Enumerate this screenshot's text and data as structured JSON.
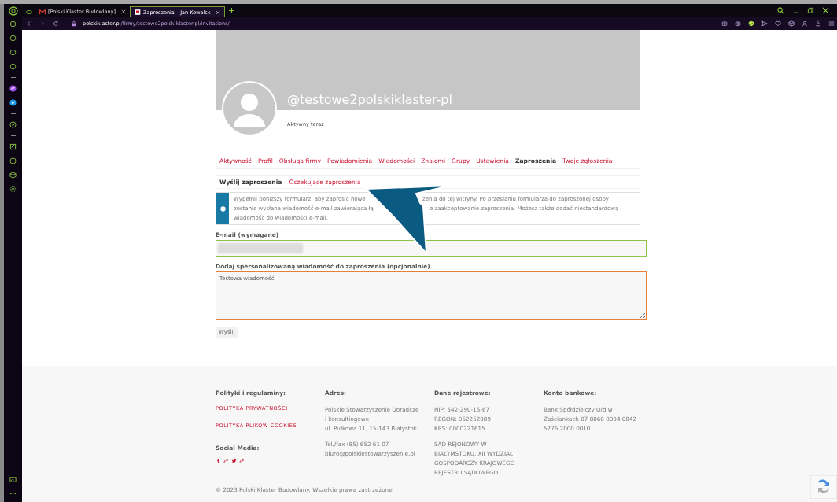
{
  "browser": {
    "tabs": [
      {
        "kind": "game",
        "selected": false
      },
      {
        "kind": "mail",
        "title": "[Polski Klaster Budowlany]",
        "selected": false
      },
      {
        "kind": "site",
        "title": "Zaproszenia – Jan Kowalsk",
        "selected": true
      }
    ],
    "url": {
      "domain": "polskiklaster.pl",
      "path": "/firmy/testowe2polskiklaster-pl/invitations/"
    }
  },
  "profile": {
    "username": "@testowe2polskiklaster-pl",
    "status": "Aktywny teraz"
  },
  "nav": [
    {
      "label": "Aktywność",
      "selected": false
    },
    {
      "label": "Profil",
      "selected": false
    },
    {
      "label": "Obsługa firmy",
      "selected": false
    },
    {
      "label": "Powiadomienia",
      "selected": false
    },
    {
      "label": "Wiadomości",
      "selected": false
    },
    {
      "label": "Znajomi",
      "selected": false
    },
    {
      "label": "Grupy",
      "selected": false
    },
    {
      "label": "Ustawienia",
      "selected": false
    },
    {
      "label": "Zaproszenia",
      "selected": true
    },
    {
      "label": "Twoje zgłoszenia",
      "selected": false
    }
  ],
  "subnav": [
    {
      "label": "Wyślij zaproszenia",
      "selected": true
    },
    {
      "label": "Oczekujące zaproszenia",
      "selected": false
    }
  ],
  "info": {
    "lines": [
      {
        "left": "Wypełnij poniższy formularz, aby zaprosić nowe",
        "right": "zenia do tej witryny. Po przesłaniu formularza do zaproszonej osoby"
      },
      {
        "left": "zostanie wysłana wiadomość e-mail zawierająca łą",
        "right": "e zaakceptowanie zaproszenia. Możesz także dodać niestandardową"
      },
      {
        "left": "wiadomość do wiadomości e-mail."
      }
    ]
  },
  "form": {
    "email": {
      "label": "E-mail (wymagane)"
    },
    "message": {
      "label": "Dodaj spersonalizowaną wiadomość do zaproszenia (opcjonalnie)",
      "value": "Testowa wiadomość"
    },
    "submit": "Wyślij"
  },
  "footer": {
    "columns": [
      {
        "kind": "links",
        "heading": "Polityki i regulaminy:",
        "links": [
          "POLITYKA PRYWATNOŚCI",
          "POLITYKA PLIKÓW COOKIES"
        ],
        "sub_heading": "Social Media:"
      },
      {
        "kind": "text",
        "heading": "Adres:",
        "paragraphs": [
          [
            "Polskie Stowarzyszenie Doradcze",
            "i konsultingowe",
            "ul. Pułkowa 11, 15-143 Białystok"
          ],
          [
            "Tel./fax (85) 652 61 07",
            "biuro@polskiestowarzyszenie.pl"
          ]
        ]
      },
      {
        "kind": "text",
        "heading": "Dane rejestrowe:",
        "paragraphs": [
          [
            "NIP: 542-290-15-67",
            "REGON: 052252089",
            "KRS: 0000221615"
          ],
          [
            "SĄD REJONOWY W",
            "BIAŁYMSTOKU, XII WYDZIAŁ",
            "GOSPODARCZY KRAJOWEGO",
            "REJESTRU SĄDOWEGO"
          ]
        ]
      },
      {
        "kind": "text",
        "heading": "Konto bankowe:",
        "paragraphs": [
          [
            "Bank Spółdzielczy O/d w",
            "Zaściankach 07 8060 0004 0842",
            "5276 2000 0010"
          ]
        ]
      }
    ],
    "copyright": "© 2023 Polski Klaster Budowlany. Wszelkie prawa zastrzeżone."
  }
}
